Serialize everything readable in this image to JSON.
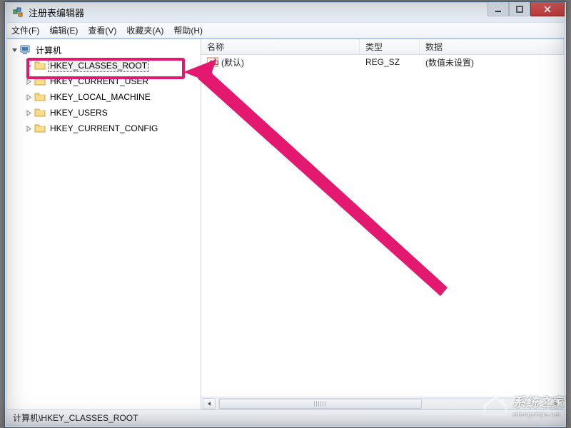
{
  "window": {
    "title": "注册表编辑器"
  },
  "menu": {
    "file": "文件(F)",
    "edit": "编辑(E)",
    "view": "查看(V)",
    "favorites": "收藏夹(A)",
    "help": "帮助(H)"
  },
  "tree": {
    "root": "计算机",
    "nodes": [
      "HKEY_CLASSES_ROOT",
      "HKEY_CURRENT_USER",
      "HKEY_LOCAL_MACHINE",
      "HKEY_USERS",
      "HKEY_CURRENT_CONFIG"
    ],
    "selected_index": 0
  },
  "columns": {
    "name": "名称",
    "type": "类型",
    "data": "数据"
  },
  "values": [
    {
      "name": "(默认)",
      "type": "REG_SZ",
      "data": "(数值未设置)"
    }
  ],
  "status": {
    "path": "计算机\\HKEY_CLASSES_ROOT"
  },
  "annotation": {
    "highlight_color": "#e3196f"
  },
  "watermark": {
    "text": "系统之家",
    "sub": "xitongzhijia.net"
  }
}
